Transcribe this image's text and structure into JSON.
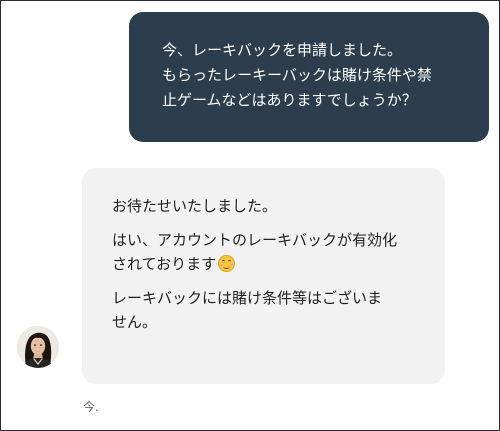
{
  "chat": {
    "user_message": {
      "lines": [
        "今、レーキバックを申請しました。",
        "もらったレーキーバックは賭け条件や禁",
        "止ゲームなどはありますでしょうか？"
      ],
      "background": "#2c3e4e"
    },
    "agent_message": {
      "paragraph1": "お待たせいたしました。",
      "paragraph2_line1": "はい、アカウントのレーキバックが有効化",
      "paragraph2_line2": "されております",
      "paragraph2_emoji": "smiling-face-icon",
      "paragraph3_line1": "レーキバックには賭け条件等はございま",
      "paragraph3_line2": "せん。",
      "background": "#f2f2f2"
    },
    "agent_avatar": "agent-avatar-photo",
    "timestamp": "今."
  }
}
